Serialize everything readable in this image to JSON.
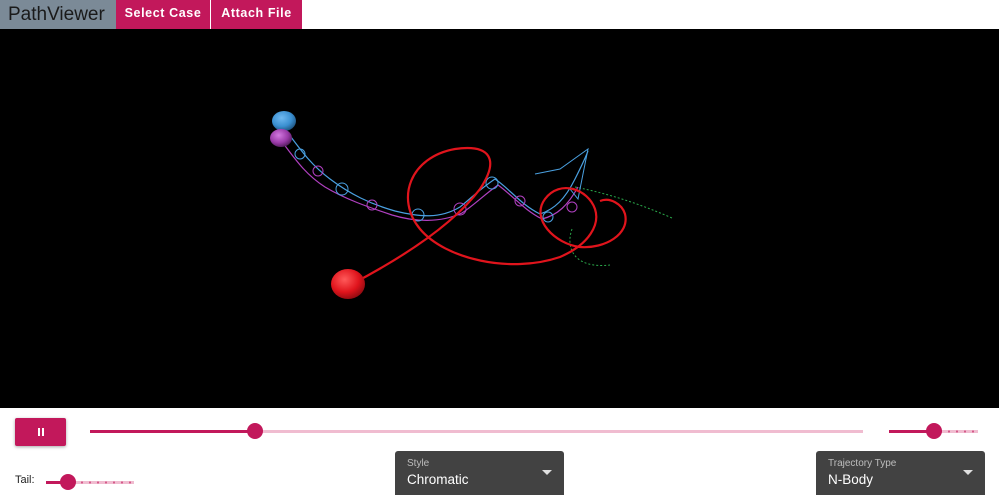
{
  "app": {
    "title": "PathViewer",
    "buttons": {
      "select_case": "Select Case",
      "attach_file": "Attach File"
    }
  },
  "playback": {
    "state": "playing",
    "play_icon": "pause-icon",
    "time_progress": 0.213,
    "speed_level": 0.5
  },
  "tail": {
    "label": "Tail:",
    "level": 0.25
  },
  "style_select": {
    "label": "Style",
    "value": "Chromatic"
  },
  "trajectory_select": {
    "label": "Trajectory Type",
    "value": "N-Body"
  },
  "colors": {
    "accent": "#c2185b",
    "accent_light": "#f0bcd0",
    "brand_bg": "#7b8a97",
    "viewer_bg": "#000000",
    "select_bg": "#424242",
    "body_red": "#e0141c",
    "body_blue": "#3a8fd0",
    "body_purple": "#9a3aa8",
    "trail_green": "#2aa84a"
  }
}
